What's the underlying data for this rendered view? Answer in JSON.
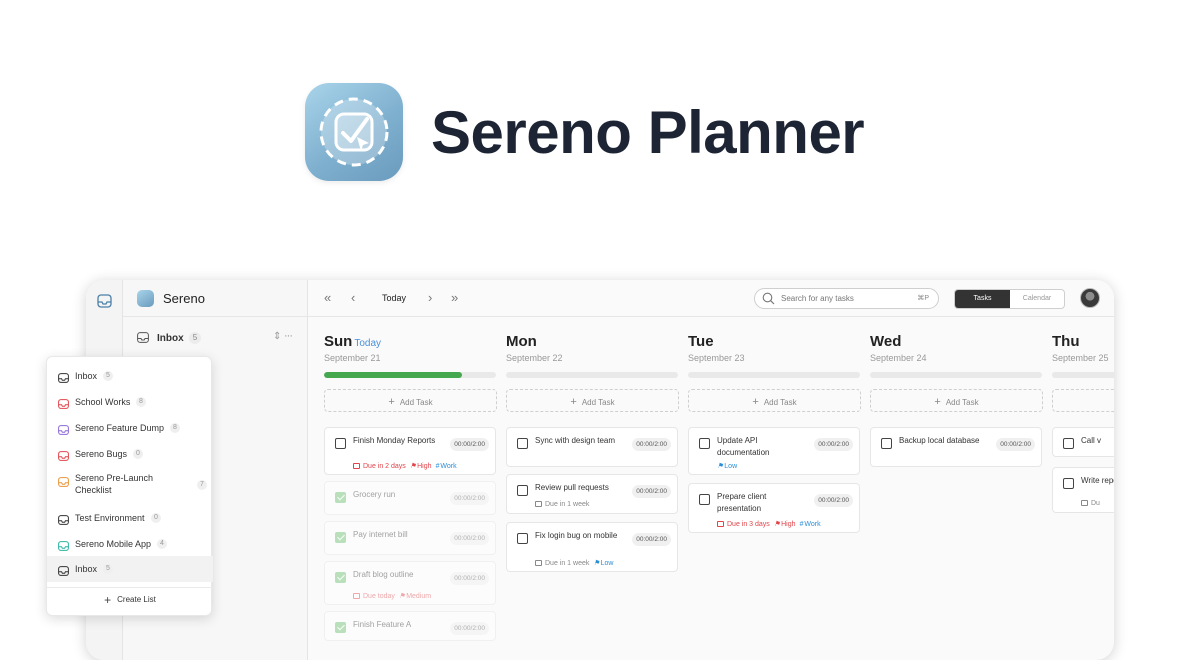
{
  "hero": {
    "title": "Sereno Planner"
  },
  "sidebar": {
    "title": "Sereno",
    "current": {
      "label": "Inbox",
      "count": "5"
    },
    "lists": [
      {
        "label": "Inbox",
        "count": "5",
        "color": "#333333"
      },
      {
        "label": "School Works",
        "count": "8",
        "color": "#e0454b"
      },
      {
        "label": "Sereno Feature Dump",
        "count": "8",
        "color": "#8c6ad6"
      },
      {
        "label": "Sereno Bugs",
        "count": "0",
        "color": "#e0454b"
      },
      {
        "label": "Sereno Pre-Launch Checklist",
        "count": "7",
        "color": "#e8953a"
      },
      {
        "label": "Test Environment",
        "count": "0",
        "color": "#333333"
      },
      {
        "label": "Sereno Mobile App",
        "count": "4",
        "color": "#2bb3a3"
      },
      {
        "label": "Inbox",
        "count": "5",
        "color": "#333333"
      }
    ],
    "create_label": "Create List"
  },
  "toolbar": {
    "today_label": "Today",
    "search_placeholder": "Search for any tasks",
    "search_shortcut": "⌘P",
    "view_tasks": "Tasks",
    "view_calendar": "Calendar"
  },
  "days": [
    {
      "name": "Sun",
      "today_label": "Today",
      "date": "September 21",
      "progress": 0.8,
      "tasks": [
        {
          "title": "Finish Monday Reports",
          "time": "00:00/2:00",
          "due": "Due in 2 days",
          "priority": "High",
          "tag": "Work"
        },
        {
          "title": "Grocery run",
          "time": "00:00/2:00",
          "done": true
        },
        {
          "title": "Pay internet bill",
          "time": "00:00/2:00",
          "done": true
        },
        {
          "title": "Draft blog outline",
          "time": "00:00/2:00",
          "done": true,
          "due": "Due today",
          "priority": "Medium"
        },
        {
          "title": "Finish Feature A",
          "time": "00:00/2:00",
          "done": true
        }
      ]
    },
    {
      "name": "Mon",
      "date": "September 22",
      "progress": 0,
      "tasks": [
        {
          "title": "Sync with design team",
          "time": "00:00/2:00"
        },
        {
          "title": "Review pull requests",
          "time": "00:00/2:00",
          "due": "Due in 1 week"
        },
        {
          "title": "Fix login bug on mobile",
          "time": "00:00/2:00",
          "due": "Due in 1 week",
          "priority": "Low"
        }
      ]
    },
    {
      "name": "Tue",
      "date": "September 23",
      "progress": 0,
      "tasks": [
        {
          "title": "Update API documentation",
          "time": "00:00/2:00",
          "priority": "Low"
        },
        {
          "title": "Prepare client presentation",
          "time": "00:00/2:00",
          "due": "Due in 3 days",
          "priority": "High",
          "tag": "Work"
        }
      ]
    },
    {
      "name": "Wed",
      "date": "September 24",
      "progress": 0,
      "tasks": [
        {
          "title": "Backup local database",
          "time": "00:00/2:00"
        }
      ]
    },
    {
      "name": "Thu",
      "date": "September 25",
      "progress": 0,
      "tasks": [
        {
          "title": "Call v",
          "time": ""
        },
        {
          "title": "Write repor",
          "time": "",
          "due": "Du"
        }
      ]
    }
  ],
  "add_task_label": "Add Task",
  "colors": {
    "accent_green": "#45a84f",
    "today_blue": "#4a90d9",
    "high_red": "#e0454b",
    "tag_blue": "#2c8fd6"
  }
}
